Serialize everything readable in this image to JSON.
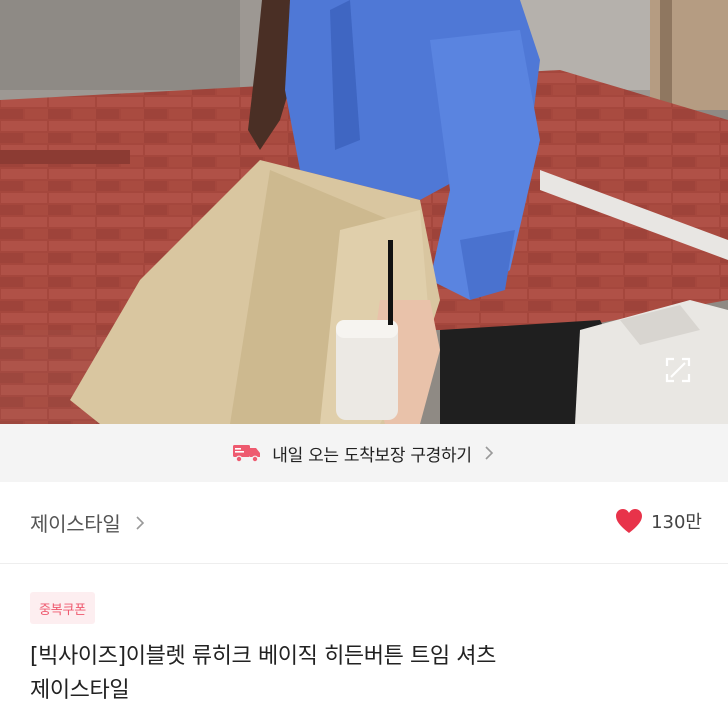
{
  "product_photo": {
    "alt": "",
    "zoom_icon": "expand-icon"
  },
  "delivery_banner": {
    "icon": "delivery-truck-icon",
    "text": "내일 오는 도착보장 구경하기",
    "chevron_icon": "chevron-right-icon"
  },
  "store": {
    "name": "제이스타일",
    "chevron_icon": "chevron-right-icon",
    "like_icon": "heart-icon",
    "like_count": "130만"
  },
  "product": {
    "badge": "중복쿠폰",
    "title_line1": "[빅사이즈]이블렛 류히크 베이직 히든버튼 트임 셔츠",
    "title_line2": "제이스타일"
  },
  "colors": {
    "accent": "#ee5a6f",
    "heart": "#e8334a",
    "banner_bg": "#f4f4f4",
    "badge_bg": "#fdeef0"
  }
}
